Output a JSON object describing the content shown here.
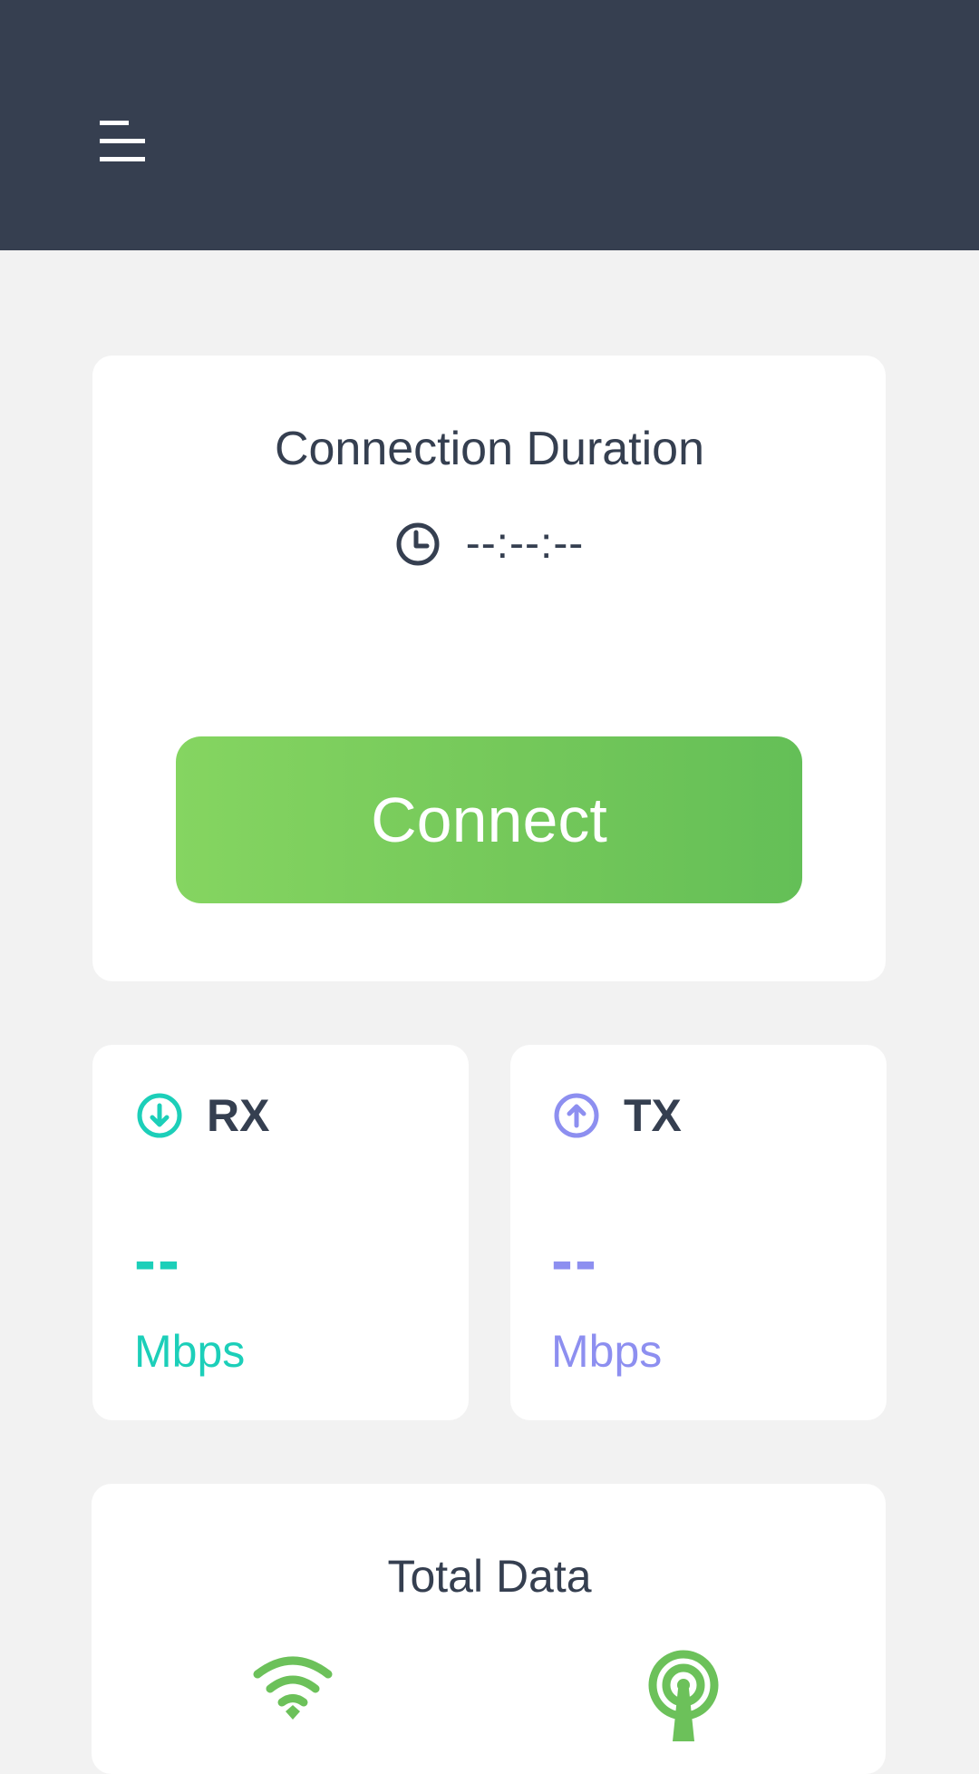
{
  "header": {
    "menu_icon": "menu-icon",
    "background": "#363f50"
  },
  "connection": {
    "title": "Connection Duration",
    "clock_icon": "clock-icon",
    "timer": "--:--:--",
    "connect_label": "Connect",
    "button_color": "#74c85a"
  },
  "rx": {
    "icon": "download-arrow-icon",
    "label": "RX",
    "value": "--",
    "unit": "Mbps",
    "color": "#1ccfb9"
  },
  "tx": {
    "icon": "upload-arrow-icon",
    "label": "TX",
    "value": "--",
    "unit": "Mbps",
    "color": "#8d8ff0"
  },
  "total": {
    "title": "Total Data",
    "icons": [
      "wifi-icon",
      "cellular-antenna-icon"
    ]
  }
}
